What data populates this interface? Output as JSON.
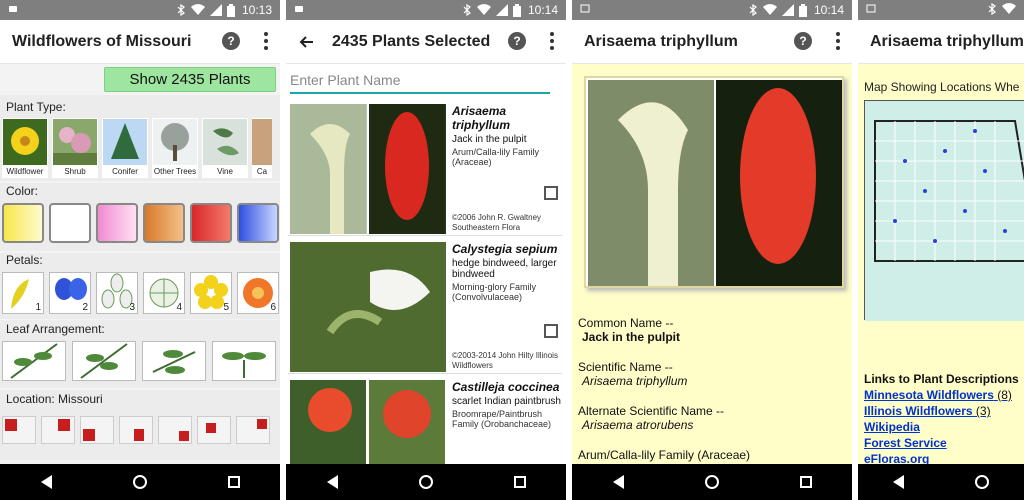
{
  "status": {
    "time": "10:13",
    "time2": "10:14"
  },
  "screen1": {
    "title": "Wildflowers of Missouri",
    "show_button": "Show 2435 Plants",
    "plant_type_label": "Plant Type:",
    "plant_types": [
      "Wildflower",
      "Shrub",
      "Conifer",
      "Other Trees",
      "Vine",
      "Ca"
    ],
    "color_label": "Color:",
    "colors": [
      "#f7e64a",
      "#ffffff",
      "#f3a4d8",
      "#e58f3f",
      "#d9262b",
      "#4b6fe0"
    ],
    "petals_label": "Petals:",
    "petals": [
      "1",
      "2",
      "3",
      "4",
      "5",
      "6"
    ],
    "leaf_label": "Leaf Arrangement:",
    "location_label": "Location: Missouri"
  },
  "screen2": {
    "title": "2435 Plants Selected",
    "search_placeholder": "Enter Plant Name",
    "plants": [
      {
        "sci": "Arisaema triphyllum",
        "common": "Jack in the pulpit",
        "family": "Arum/Calla-lily Family (Araceae)",
        "credit": "©2006 John R. Gwaltney Southeastern Flora"
      },
      {
        "sci": "Calystegia sepium",
        "common": "hedge bindweed, larger bindweed",
        "family": "Morning-glory Family (Convolvulaceae)",
        "credit": "©2003-2014 John Hilty Illinois Wildflowers"
      },
      {
        "sci": "Castilleja coccinea",
        "common": "scarlet Indian paintbrush",
        "family": "Broomrape/Paintbrush Family (Orobanchaceae)",
        "credit": ""
      }
    ]
  },
  "screen3": {
    "title": "Arisaema triphyllum",
    "common_label": "Common Name --",
    "common_value": "Jack in the pulpit",
    "sci_label": "Scientific Name --",
    "sci_value": "Arisaema triphyllum",
    "alt_label": "Alternate Scientific Name --",
    "alt_value": "Arisaema atrorubens",
    "family": "Arum/Calla-lily Family (Araceae)"
  },
  "screen4": {
    "title": "Arisaema triphyllum",
    "map_caption": "Map Showing Locations Whe",
    "links_title": "Links to Plant Descriptions",
    "links": [
      {
        "label": "Minnesota Wildflowers",
        "count": "(8)"
      },
      {
        "label": "Illinois Wildflowers",
        "count": "(3)"
      },
      {
        "label": "Wikipedia",
        "count": ""
      },
      {
        "label": "Forest Service",
        "count": ""
      },
      {
        "label": "eFloras.org",
        "count": ""
      }
    ]
  }
}
